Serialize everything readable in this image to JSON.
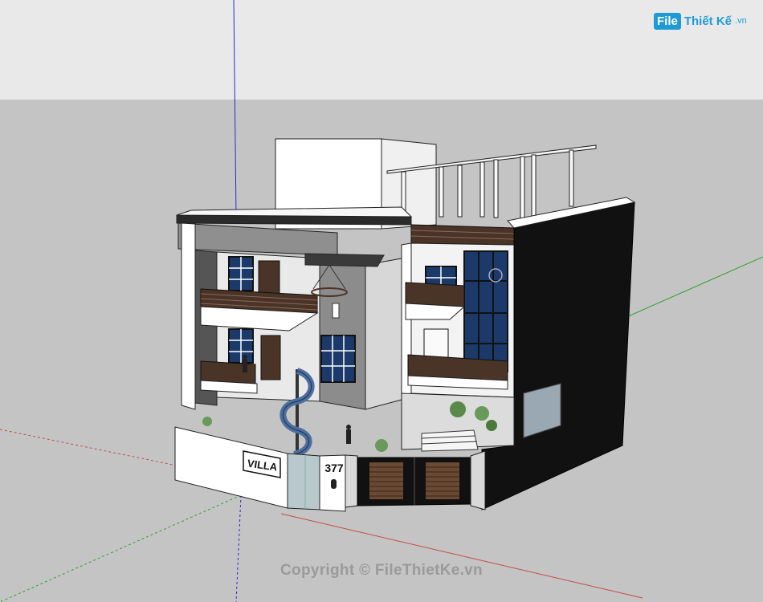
{
  "watermark": {
    "badge": "File",
    "text": "Thiết Kế",
    "suffix": ".vn",
    "copyright": "Copyright © FileThietKe.vn"
  },
  "house": {
    "nameplate": "VILLA",
    "house_number": "377"
  },
  "colors": {
    "sky": "#e9e9e9",
    "ground": "#c4c4c4",
    "axis_blue": "#2a2ad6",
    "axis_green": "#2fa12f",
    "axis_red": "#c44a4a",
    "wall_white": "#ffffff",
    "wall_grey": "#8f8f8f",
    "wall_black": "#111111",
    "wood": "#4a3428",
    "glass": "#1b3a6a"
  }
}
